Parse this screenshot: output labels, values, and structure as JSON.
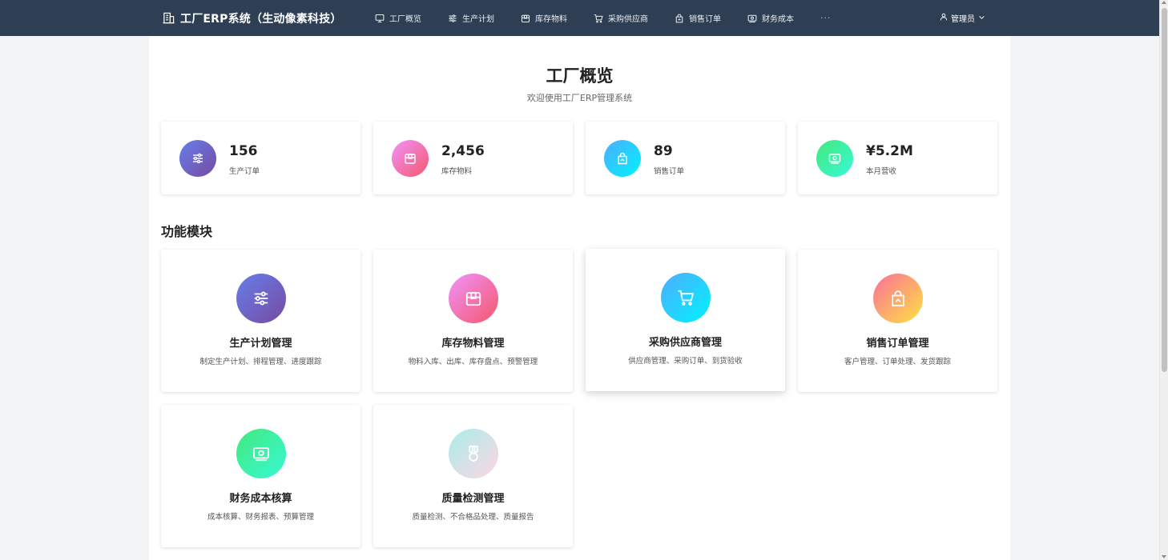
{
  "header": {
    "brand_title": "工厂ERP系统（生动像素科技）",
    "brand_icon": "building-icon",
    "nav": [
      {
        "label": "工厂概览",
        "icon": "monitor-icon"
      },
      {
        "label": "生产计划",
        "icon": "sliders-icon"
      },
      {
        "label": "库存物料",
        "icon": "box-icon"
      },
      {
        "label": "采购供应商",
        "icon": "cart-icon"
      },
      {
        "label": "销售订单",
        "icon": "shopping-bag-icon"
      },
      {
        "label": "财务成本",
        "icon": "money-icon"
      }
    ],
    "more_label": "···",
    "user_label": "管理员",
    "background_color": "#2e3e53"
  },
  "page": {
    "title": "工厂概览",
    "subtitle": "欢迎使用工厂ERP管理系统"
  },
  "stats": [
    {
      "value": "156",
      "label": "生产订单",
      "icon": "sliders-icon",
      "colors": [
        "#667eea",
        "#764ba2"
      ]
    },
    {
      "value": "2,456",
      "label": "库存物料",
      "icon": "box-icon",
      "colors": [
        "#f093fb",
        "#f5576c"
      ]
    },
    {
      "value": "89",
      "label": "销售订单",
      "icon": "shopping-bag-icon",
      "colors": [
        "#4facfe",
        "#00f2fe"
      ]
    },
    {
      "value": "¥5.2M",
      "label": "本月营收",
      "icon": "money-icon",
      "colors": [
        "#43e97b",
        "#38f9d7"
      ]
    }
  ],
  "section_title": "功能模块",
  "modules": [
    {
      "title": "生产计划管理",
      "desc": "制定生产计划、排程管理、进度跟踪",
      "icon": "sliders-icon",
      "colors": [
        "#667eea",
        "#764ba2"
      ]
    },
    {
      "title": "库存物料管理",
      "desc": "物料入库、出库、库存盘点、预警管理",
      "icon": "box-icon",
      "colors": [
        "#f093fb",
        "#f5576c"
      ]
    },
    {
      "title": "采购供应商管理",
      "desc": "供应商管理、采购订单、到货验收",
      "icon": "cart-icon",
      "colors": [
        "#4facfe",
        "#00f2fe"
      ]
    },
    {
      "title": "销售订单管理",
      "desc": "客户管理、订单处理、发货跟踪",
      "icon": "shopping-bag-icon",
      "colors": [
        "#fa709a",
        "#fee140"
      ]
    },
    {
      "title": "财务成本核算",
      "desc": "成本核算、财务报表、预算管理",
      "icon": "money-icon",
      "colors": [
        "#43e97b",
        "#38f9d7"
      ]
    },
    {
      "title": "质量检测管理",
      "desc": "质量检测、不合格品处理、质量报告",
      "icon": "medal-icon",
      "colors": [
        "#a8edea",
        "#fed6e3"
      ]
    }
  ]
}
